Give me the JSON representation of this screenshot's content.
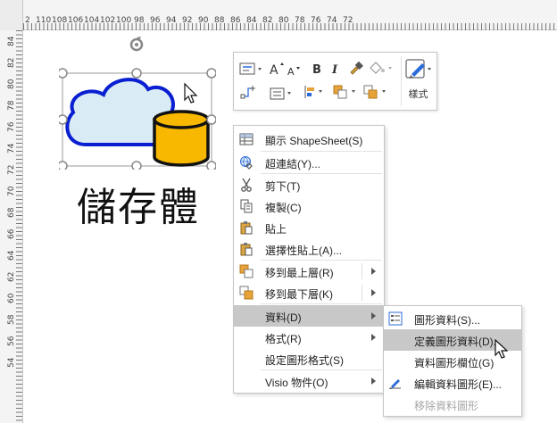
{
  "ruler": {
    "top_labels": [
      "2",
      "110",
      "108",
      "106",
      "104",
      "102",
      "100",
      "98",
      "96",
      "94",
      "92",
      "90",
      "88",
      "86",
      "84",
      "82",
      "80",
      "78",
      "76",
      "74",
      "72"
    ],
    "left_labels": [
      "84",
      "82",
      "80",
      "78",
      "76",
      "74",
      "72",
      "70",
      "68",
      "66",
      "64",
      "62",
      "60",
      "58",
      "56",
      "54"
    ]
  },
  "shape": {
    "caption": "儲存體",
    "cloud_fill": "#d9ecf5",
    "cloud_stroke": "#0a1fd1",
    "cylinder_fill": "#f8b800",
    "cylinder_stroke": "#111111"
  },
  "minibar": {
    "style_label": "樣式"
  },
  "context_menu": {
    "items": [
      {
        "label": "顯示 ShapeSheet(S)"
      },
      {
        "label": "超連結(Y)..."
      },
      {
        "label": "剪下(T)"
      },
      {
        "label": "複製(C)"
      },
      {
        "label": "貼上"
      },
      {
        "label": "選擇性貼上(A)..."
      },
      {
        "label": "移到最上層(R)"
      },
      {
        "label": "移到最下層(K)"
      },
      {
        "label": "資料(D)"
      },
      {
        "label": "格式(R)"
      },
      {
        "label": "設定圖形格式(S)"
      },
      {
        "label": "Visio 物件(O)"
      }
    ]
  },
  "data_submenu": {
    "items": [
      {
        "label": "圖形資料(S)..."
      },
      {
        "label": "定義圖形資料(D)..."
      },
      {
        "label": "資料圖形欄位(G)"
      },
      {
        "label": "編輯資料圖形(E)..."
      },
      {
        "label": "移除資料圖形"
      }
    ]
  },
  "colors": {
    "highlight": "#c8c8c8",
    "selection_handle": "#888888"
  }
}
